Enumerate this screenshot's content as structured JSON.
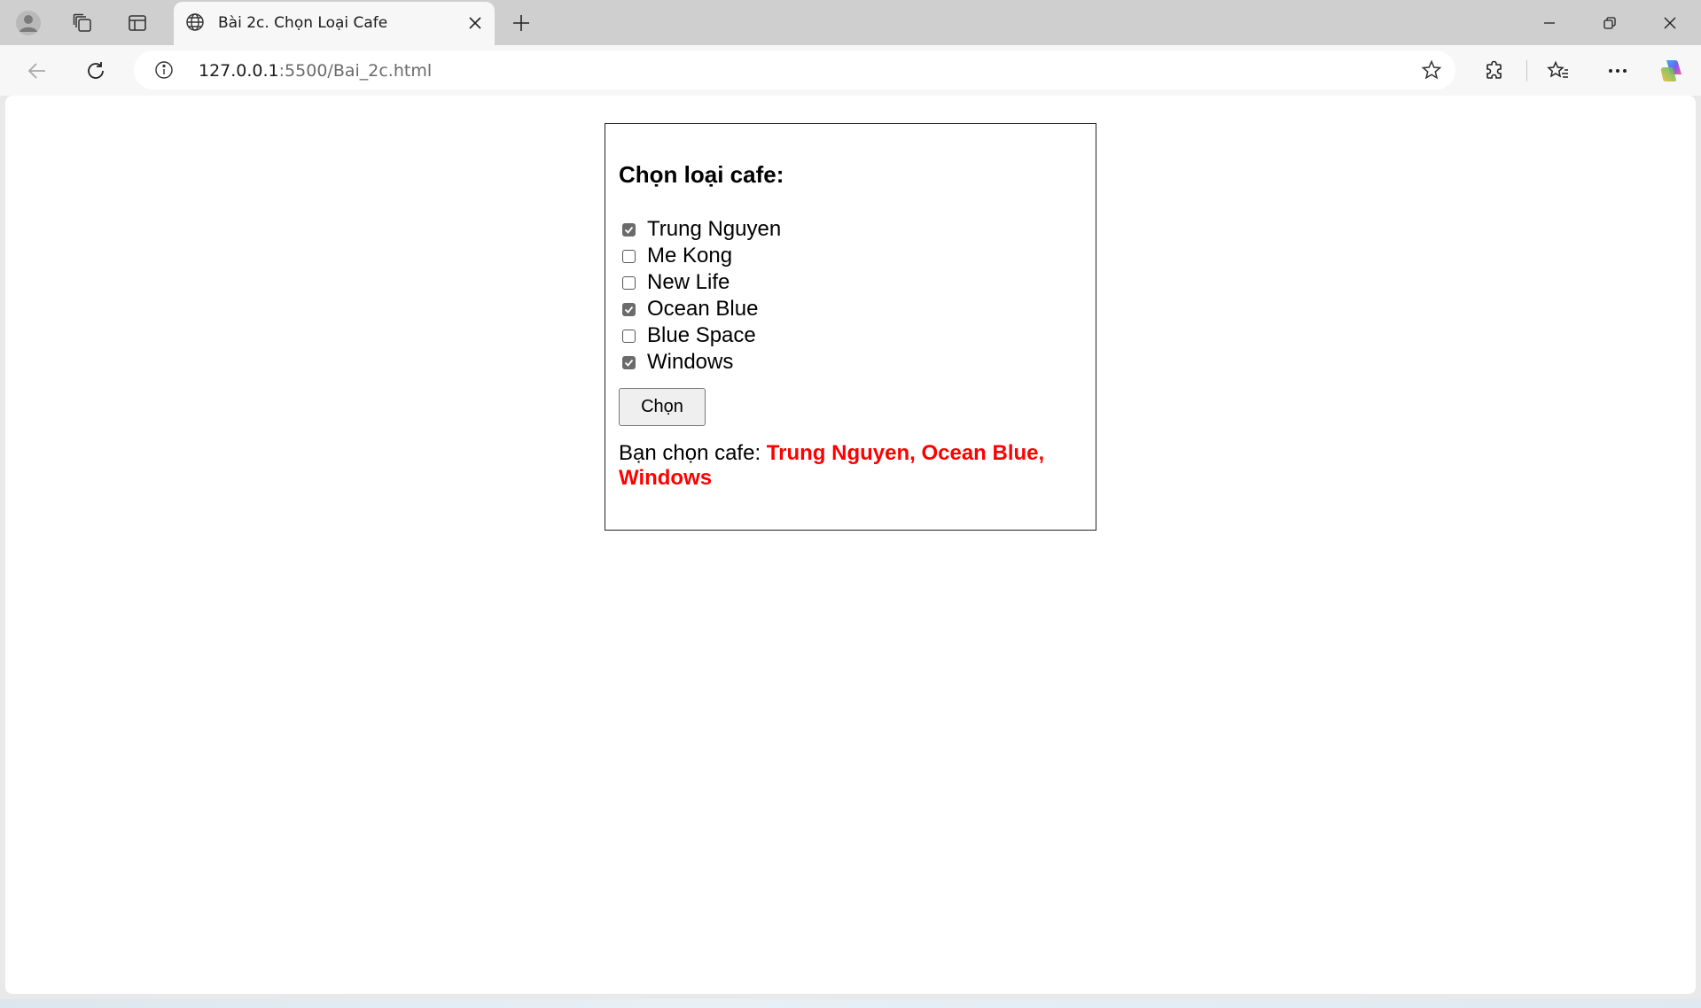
{
  "browser": {
    "tab_title": "Bài 2c. Chọn Loại Cafe",
    "url_host": "127.0.0.1",
    "url_rest": ":5500/Bai_2c.html"
  },
  "page": {
    "heading": "Chọn loại cafe:",
    "options": [
      {
        "label": "Trung Nguyen",
        "checked": true
      },
      {
        "label": "Me Kong",
        "checked": false
      },
      {
        "label": "New Life",
        "checked": false
      },
      {
        "label": "Ocean Blue",
        "checked": true
      },
      {
        "label": "Blue Space",
        "checked": false
      },
      {
        "label": "Windows",
        "checked": true
      }
    ],
    "submit_label": "Chọn",
    "result_prefix": "Bạn chọn cafe: ",
    "result_value": "Trung Nguyen, Ocean Blue, Windows"
  },
  "colors": {
    "result_highlight": "#ff0000",
    "checkbox_checked": "#6b6b6b"
  },
  "icons": [
    "profile-icon",
    "collections-icon",
    "tab-actions-icon",
    "globe-icon",
    "close-icon",
    "new-tab-icon",
    "minimize-icon",
    "restore-icon",
    "window-close-icon",
    "back-icon",
    "refresh-icon",
    "info-icon",
    "favorite-star-icon",
    "extensions-icon",
    "favorites-icon",
    "more-icon",
    "copilot-icon",
    "checkmark-icon"
  ]
}
